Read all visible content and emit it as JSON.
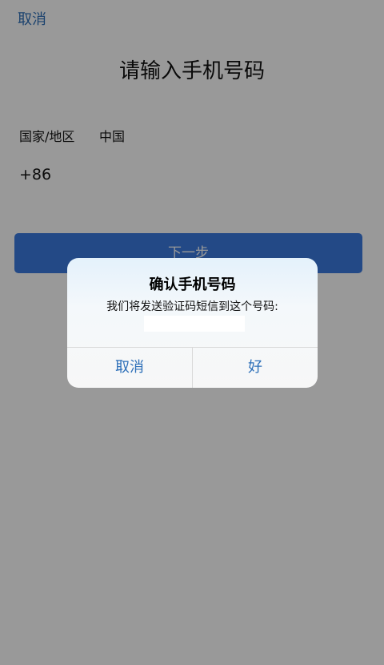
{
  "nav": {
    "cancel_label": "取消"
  },
  "page": {
    "title": "请输入手机号码"
  },
  "country": {
    "label": "国家/地区",
    "value": "中国"
  },
  "phone": {
    "country_code": "+86",
    "value": "",
    "placeholder": ""
  },
  "next_button": {
    "label": "下一步",
    "color": "#3b7be0"
  },
  "dialog": {
    "title": "确认手机号码",
    "message": "我们将发送验证码短信到这个号码:",
    "phone_display": "",
    "cancel_label": "取消",
    "ok_label": "好"
  },
  "colors": {
    "accent_link": "#2d6fb8",
    "overlay": "rgba(0,0,0,0.4)"
  }
}
